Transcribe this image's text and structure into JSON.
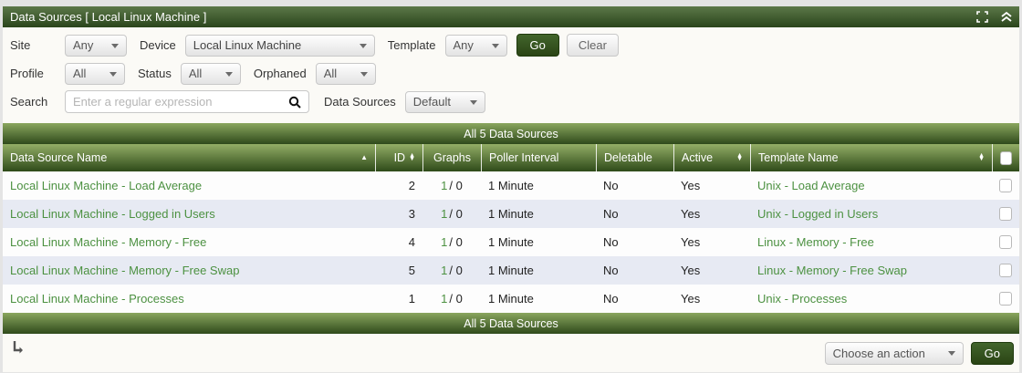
{
  "titlebar": {
    "title": "Data Sources [ Local Linux Machine ]",
    "icons": [
      "fullscreen-icon",
      "collapse-up-icon"
    ]
  },
  "filters": {
    "row1": {
      "site_label": "Site",
      "site_value": "Any",
      "device_label": "Device",
      "device_value": "Local Linux Machine",
      "template_label": "Template",
      "template_value": "Any",
      "go_label": "Go",
      "clear_label": "Clear"
    },
    "row2": {
      "profile_label": "Profile",
      "profile_value": "All",
      "status_label": "Status",
      "status_value": "All",
      "orphaned_label": "Orphaned",
      "orphaned_value": "All"
    },
    "row3": {
      "search_label": "Search",
      "search_placeholder": "Enter a regular expression",
      "datasources_label": "Data Sources",
      "datasources_value": "Default"
    }
  },
  "table": {
    "banner_top": "All 5 Data Sources",
    "banner_bottom": "All 5 Data Sources",
    "columns": {
      "name": "Data Source Name",
      "id": "ID",
      "graphs": "Graphs",
      "poller": "Poller Interval",
      "deletable": "Deletable",
      "active": "Active",
      "template": "Template Name"
    },
    "rows": [
      {
        "name": "Local Linux Machine - Load Average",
        "id": "2",
        "graphs_link": "1",
        "graphs_rest": "/ 0",
        "poller": "1 Minute",
        "deletable": "No",
        "active": "Yes",
        "template": "Unix - Load Average"
      },
      {
        "name": "Local Linux Machine - Logged in Users",
        "id": "3",
        "graphs_link": "1",
        "graphs_rest": "/ 0",
        "poller": "1 Minute",
        "deletable": "No",
        "active": "Yes",
        "template": "Unix - Logged in Users"
      },
      {
        "name": "Local Linux Machine - Memory - Free",
        "id": "4",
        "graphs_link": "1",
        "graphs_rest": "/ 0",
        "poller": "1 Minute",
        "deletable": "No",
        "active": "Yes",
        "template": "Linux - Memory - Free"
      },
      {
        "name": "Local Linux Machine - Memory - Free Swap",
        "id": "5",
        "graphs_link": "1",
        "graphs_rest": "/ 0",
        "poller": "1 Minute",
        "deletable": "No",
        "active": "Yes",
        "template": "Linux - Memory - Free Swap"
      },
      {
        "name": "Local Linux Machine - Processes",
        "id": "1",
        "graphs_link": "1",
        "graphs_rest": "/ 0",
        "poller": "1 Minute",
        "deletable": "No",
        "active": "Yes",
        "template": "Unix - Processes"
      }
    ]
  },
  "footer": {
    "action_value": "Choose an action",
    "go_label": "Go"
  },
  "colors": {
    "header_green_dark": "#2a451c",
    "header_green_light": "#5c7849",
    "table_header_light": "#93ae66",
    "table_header_dark": "#2e4a19",
    "link_green": "#4c9141",
    "row_alt": "#e7eaf3",
    "go_button": "#2a4415"
  }
}
